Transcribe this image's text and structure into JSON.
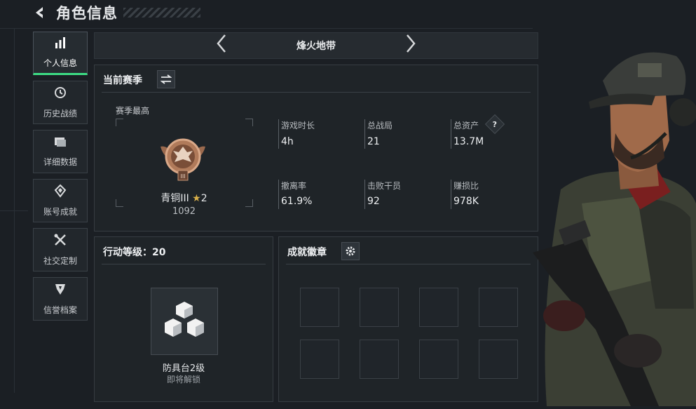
{
  "header": {
    "title": "角色信息"
  },
  "sidebar": {
    "items": [
      {
        "label": "个人信息",
        "icon": "bar-chart-icon",
        "active": true
      },
      {
        "label": "历史战绩",
        "icon": "history-icon"
      },
      {
        "label": "详细数据",
        "icon": "folder-icon"
      },
      {
        "label": "账号成就",
        "icon": "achievement-icon"
      },
      {
        "label": "社交定制",
        "icon": "tools-icon"
      },
      {
        "label": "信誉档案",
        "icon": "shield-icon"
      }
    ]
  },
  "map_selector": {
    "name": "烽火地带"
  },
  "season": {
    "title": "当前赛季",
    "best_label": "赛季最高",
    "rank_name": "青铜III",
    "rank_stars": "2",
    "rank_score": "1092",
    "rank_numeral": "III",
    "stats": [
      {
        "label": "游戏时长",
        "value": "4h"
      },
      {
        "label": "总战局",
        "value": "21"
      },
      {
        "label": "总资产",
        "value": "13.7M",
        "help": "?"
      },
      {
        "label": "撤离率",
        "value": "61.9%"
      },
      {
        "label": "击败干员",
        "value": "92"
      },
      {
        "label": "赚损比",
        "value": "978K"
      }
    ]
  },
  "action_level": {
    "title": "行动等级：20",
    "item_name": "防具台2级",
    "item_status": "即将解锁"
  },
  "badges": {
    "title": "成就徽章"
  },
  "colors": {
    "accent": "#3ddc84",
    "panel": "#1f2428",
    "bronze": "#b07a5a"
  }
}
